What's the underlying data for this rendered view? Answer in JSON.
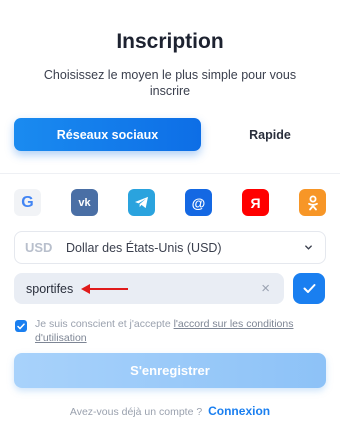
{
  "header": {
    "title": "Inscription",
    "subtitle": "Choisissez le moyen le plus simple pour vous inscrire"
  },
  "tabs": {
    "active_label": "Réseaux sociaux",
    "other_label": "Rapide"
  },
  "socials": {
    "google_letter": "G",
    "vk_letter": "vk",
    "mail_letter": "@",
    "yandex_letter": "Я"
  },
  "currency": {
    "code": "USD",
    "name": "Dollar des États-Unis (USD)"
  },
  "promo": {
    "value": "sportifes",
    "clear_glyph": "×"
  },
  "agreement": {
    "text": "Je suis conscient et j'accepte ",
    "link": "l'accord sur les conditions d'utilisation",
    "checked": true
  },
  "submit_label": "S'enregistrer",
  "login": {
    "question": "Avez-vous déjà un compte ?",
    "link": "Connexion"
  },
  "colors": {
    "primary": "#1a7ff0",
    "annotation_arrow": "#e01b1b"
  }
}
